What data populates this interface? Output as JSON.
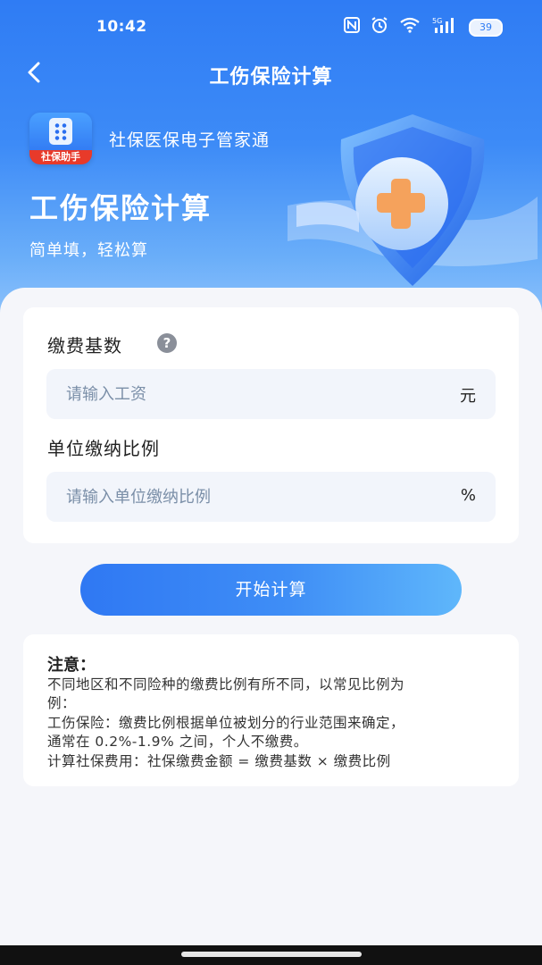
{
  "status_bar": {
    "time": "10:42",
    "icons": [
      "nfc-icon",
      "alarm-icon",
      "wifi-icon",
      "signal-5g-icon"
    ],
    "signal_label": "5G",
    "battery": "39"
  },
  "nav": {
    "back_icon": "chevron-left-icon",
    "title": "工伤保险计算"
  },
  "hero": {
    "app_icon_label": "社保助手",
    "app_name": "社保医保电子管家通",
    "title": "工伤保险计算",
    "subtitle": "简单填，轻松算"
  },
  "form": {
    "base": {
      "label": "缴费基数",
      "placeholder": "请输入工资",
      "unit": "元",
      "value": ""
    },
    "ratio": {
      "label": "单位缴纳比例",
      "placeholder": "请输入单位缴纳比例",
      "unit": "%",
      "value": ""
    }
  },
  "button": {
    "label": "开始计算"
  },
  "notice": {
    "title": "注意：",
    "lines": [
      "不同地区和不同险种的缴费比例有所不同，以常见比例为",
      "例：",
      "工伤保险：缴费比例根据单位被划分的行业范围来确定，",
      "通常在 0.2%-1.9% 之间，个人不缴费。",
      "计算社保费用：社保缴费金额 = 缴费基数 × 缴费比例"
    ]
  },
  "colors": {
    "primary": "#2f7cf4",
    "accent_orange": "#f7a35c",
    "background": "#f5f6fa"
  }
}
